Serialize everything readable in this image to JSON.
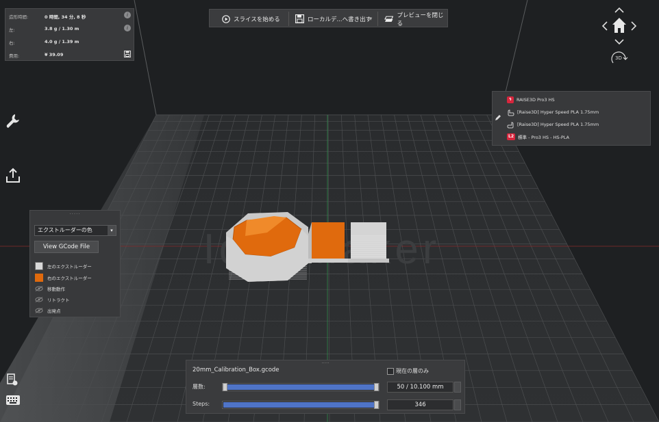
{
  "info": {
    "rows": [
      {
        "key": "造形時間:",
        "value": "0 時間, 34 分, 8 秒",
        "icon": "info-icon"
      },
      {
        "key": "左:",
        "value": "3.8 g / 1.30 m",
        "icon": "info-icon"
      },
      {
        "key": "右:",
        "value": "4.0 g / 1.39 m",
        "icon": ""
      },
      {
        "key": "費用:",
        "value": "¥ 39.09",
        "icon": "save-icon"
      }
    ]
  },
  "toolbar": {
    "slice_label": "スライスを始める",
    "export_label": "ローカルデ...へ書き出す",
    "close_preview_label": "プレビューを閉じる"
  },
  "view_nav": {
    "badge_3d": "3D"
  },
  "printer": {
    "rows": [
      {
        "label": "RAISE3D Pro3 HS",
        "icon": "lightning-icon"
      },
      {
        "label": "[Raise3D] Hyper Speed PLA 1.75mm",
        "icon": "left-hand-icon"
      },
      {
        "label": "[Raise3D] Hyper Speed PLA 1.75mm",
        "icon": "right-hand-icon"
      },
      {
        "label": "標準 - Pro3 HS - HS-PLA",
        "icon": "L2",
        "badge": "L2"
      }
    ]
  },
  "extruder_panel": {
    "drag": "·····",
    "color_mode": "エクストルーダーの色",
    "view_gcode_label": "View GCode File",
    "legend": [
      {
        "label": "左のエクストルーダー",
        "color": "#d8d8d8",
        "kind": "swatch"
      },
      {
        "label": "右のエクストルーダー",
        "color": "#e06a0d",
        "kind": "swatch"
      },
      {
        "label": "移動動作",
        "kind": "eye"
      },
      {
        "label": "リトラクト",
        "kind": "eye"
      },
      {
        "label": "出発点",
        "kind": "eye"
      }
    ]
  },
  "layers_panel": {
    "drag": "·····",
    "filename": "20mm_Calibration_Box.gcode",
    "current_layer_only_label": "現在の層のみ",
    "layers_label": "層数:",
    "layers_value": "50 / 10.100 mm",
    "steps_label": "Steps:",
    "steps_value": "346",
    "layer_progress": 1.0,
    "steps_progress": 1.0
  },
  "watermark": "IdeaMaker",
  "colors": {
    "accent_orange": "#e06a0d",
    "slider_blue": "#4f74c7",
    "brand_red": "#d7263d"
  }
}
